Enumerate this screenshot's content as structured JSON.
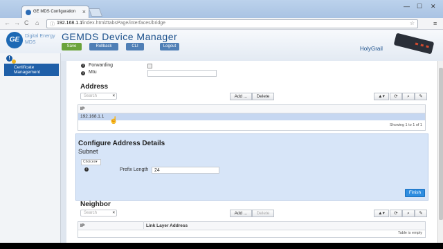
{
  "browser": {
    "tab_title": "GE MDS Configuration",
    "tab_close": "×",
    "window_controls": [
      "—",
      "☐",
      "✕"
    ],
    "nav": {
      "back": "←",
      "forward": "→",
      "reload": "C",
      "home": "⌂"
    },
    "url_host": "192.168.1.1",
    "url_path": "/index.html#tabsPage/interfaces/bridge",
    "lock_icon": "ⓘ",
    "star_icon": "☆",
    "menu_icon": "≡"
  },
  "header": {
    "logo_text": "GE",
    "brand_line1": "Digital Energy",
    "brand_line2": "MDS",
    "app_title": "GEMDS  Device  Manager",
    "buttons": {
      "save": "Save",
      "rollback": "Rollback",
      "cli": "CLI",
      "logout": "Logout"
    },
    "device_name": "HolyGrail"
  },
  "sidebar": {
    "warning_icon": "!",
    "items": [
      {
        "label": "Certificate Management"
      }
    ]
  },
  "fields": {
    "forwarding_label": "Forwarding",
    "mtu_label": "Mtu",
    "mtu_value": ""
  },
  "address": {
    "title": "Address",
    "search_placeholder": "Search",
    "clear": "×",
    "add_button": "Add ...",
    "delete_button": "Delete",
    "tools": [
      "▲▾",
      "⟳",
      "⌕",
      "✎"
    ],
    "columns": [
      "IP"
    ],
    "rows": [
      {
        "ip": "192.168.1.1"
      }
    ],
    "footer": "Showing 1 to 1 of 1"
  },
  "configure": {
    "title": "Configure Address Details",
    "subtitle": "Subnet",
    "choices_label": "Choices",
    "prefix_label": "Prefix Length",
    "prefix_value": "24",
    "finish_button": "Finish"
  },
  "neighbor": {
    "title": "Neighbor",
    "search_placeholder": "Search",
    "clear": "×",
    "add_button": "Add ...",
    "delete_button": "Delete",
    "tools": [
      "▲▾",
      "⟳",
      "⌕",
      "✎"
    ],
    "columns": [
      "IP",
      "Link Layer Address"
    ],
    "footer": "Table is empty"
  },
  "colors": {
    "accent": "#1f5fa8",
    "finish": "#2e8de0",
    "panel": "#d7e5f8",
    "selected_row": "#c6d7f1"
  }
}
